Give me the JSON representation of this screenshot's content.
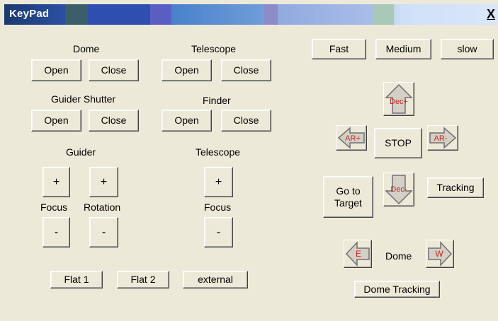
{
  "window": {
    "title": "KeyPad",
    "close_glyph": "X"
  },
  "dome_group": {
    "heading": "Dome",
    "open": "Open",
    "close": "Close"
  },
  "telescope_group": {
    "heading": "Telescope",
    "open": "Open",
    "close": "Close"
  },
  "guider_shutter_group": {
    "heading": "Guider Shutter",
    "open": "Open",
    "close": "Close"
  },
  "finder_group": {
    "heading": "Finder",
    "open": "Open",
    "close": "Close"
  },
  "guider_focus": {
    "heading": "Guider",
    "focus_label": "Focus",
    "rotation_label": "Rotation",
    "plus": "+",
    "minus": "-"
  },
  "telescope_focus": {
    "heading": "Telescope",
    "focus_label": "Focus",
    "plus": "+",
    "minus": "-"
  },
  "bottom_buttons": {
    "flat1": "Flat 1",
    "flat2": "Flat 2",
    "external": "external"
  },
  "speed": {
    "fast": "Fast",
    "medium": "Medium",
    "slow": "slow"
  },
  "move": {
    "dec_plus": "Dec+",
    "dec_minus": "Dec-",
    "ar_plus": "AR+",
    "ar_minus": "AR-",
    "stop": "STOP",
    "go_to_target": "Go to Target",
    "tracking": "Tracking"
  },
  "dome_move": {
    "label": "Dome",
    "east": "E",
    "west": "W",
    "dome_tracking": "Dome Tracking"
  },
  "icons": {
    "up": "arrow-up-icon",
    "down": "arrow-down-icon",
    "left": "arrow-left-icon",
    "right": "arrow-right-icon"
  },
  "colors": {
    "window_bg": "#ece9d8",
    "arrow_text": "#c8281e",
    "arrow_fill": "#d4d0c8"
  }
}
